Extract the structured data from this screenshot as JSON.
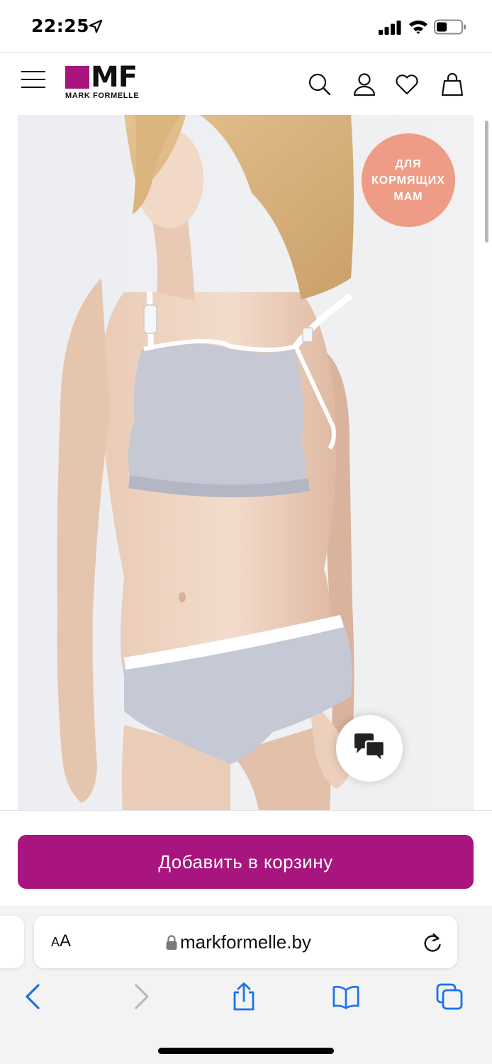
{
  "status_bar": {
    "time": "22:25",
    "icons": [
      "location-arrow-icon",
      "cellular-signal-icon",
      "wifi-icon",
      "battery-icon"
    ]
  },
  "header": {
    "logo_letters": "MF",
    "logo_subtitle": "MARK FORMELLE",
    "brand_color": "#a8157e",
    "icons": [
      "menu-icon",
      "search-icon",
      "account-icon",
      "wishlist-heart-icon",
      "shopping-bag-icon"
    ]
  },
  "product": {
    "badge_lines": [
      "ДЛЯ",
      "КОРМЯЩИХ",
      "МАМ"
    ],
    "badge_color": "#ee9c85",
    "image_alt_icon": "product-photo"
  },
  "cart": {
    "button_label": "Добавить в корзину"
  },
  "browser": {
    "aa_label_small": "A",
    "aa_label_large": "A",
    "url": "markformelle.by",
    "toolbar_icons": [
      "back-icon",
      "forward-icon",
      "share-icon",
      "bookmarks-icon",
      "tabs-icon"
    ]
  }
}
